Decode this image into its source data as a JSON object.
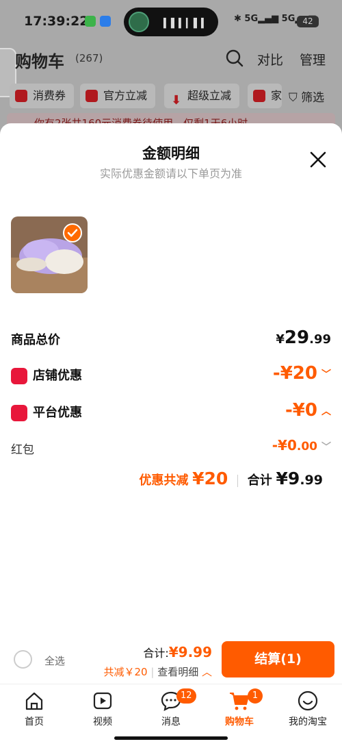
{
  "status": {
    "time": "17:39:22",
    "network1": "5G",
    "network2": "5G",
    "battery": "42"
  },
  "background": {
    "title": "购物车",
    "count": "(267)",
    "compare": "对比",
    "manage": "管理",
    "chips": [
      "消费券",
      "官方立减",
      "超级立减",
      "家"
    ],
    "filter": "筛选",
    "notice": "你有2张共160元消费券待使用，仅剩1天6小时"
  },
  "sheet": {
    "title": "金额明细",
    "subtitle": "实际优惠金额请以下单页为准",
    "total_label": "商品总价",
    "total_int": "29",
    "total_dec": ".99",
    "store_label": "店铺优惠",
    "store_value": "-¥20",
    "platform_label": "平台优惠",
    "platform_value": "-¥0",
    "redpacket_label": "红包",
    "redpacket_value": "-¥0",
    "redpacket_dec": ".00",
    "saved_label": "优惠共减",
    "saved_value": "¥20",
    "sum_label": "合计",
    "sum_int": "¥9",
    "sum_dec": ".99"
  },
  "bottombar": {
    "select_all": "全选",
    "total_label": "合计:",
    "total_value": "¥9.99",
    "saved": "共减￥20",
    "detail": "查看明细",
    "checkout": "结算(1)"
  },
  "tabs": [
    {
      "label": "首页",
      "icon": "home-icon"
    },
    {
      "label": "视频",
      "icon": "video-icon"
    },
    {
      "label": "消息",
      "icon": "message-icon",
      "badge": "12"
    },
    {
      "label": "购物车",
      "icon": "cart-icon",
      "badge": "1"
    },
    {
      "label": "我的淘宝",
      "icon": "profile-icon"
    }
  ],
  "colors": {
    "accent": "#ff5b00",
    "badge_red": "#e8173b"
  }
}
